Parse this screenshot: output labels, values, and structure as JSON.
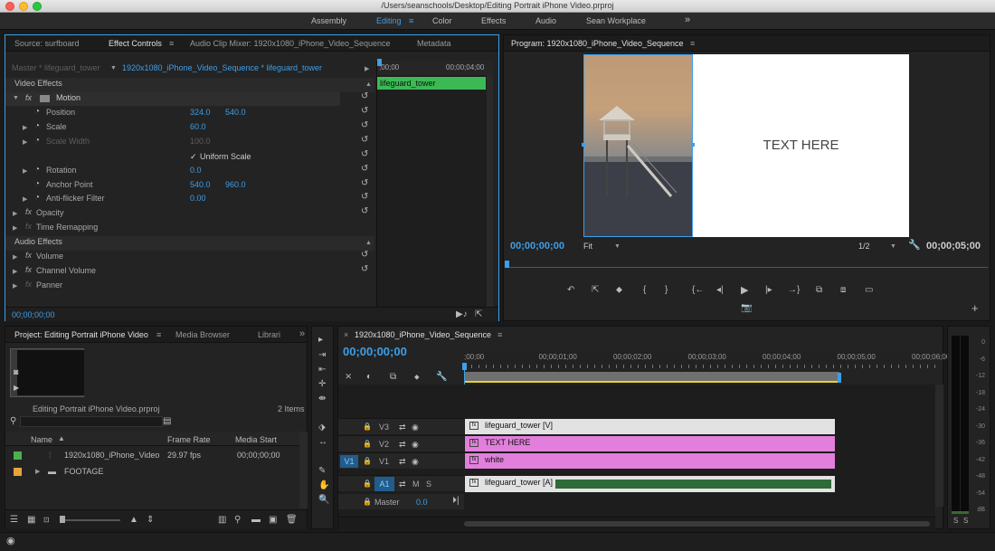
{
  "window": {
    "title": "/Users/seanschools/Desktop/Editing Portrait iPhone Video.prproj"
  },
  "workspaces": {
    "items": [
      "Assembly",
      "Editing",
      "Color",
      "Effects",
      "Audio",
      "Sean Workplace"
    ],
    "more": "»"
  },
  "source_panel": {
    "tabs": [
      "Source: surfboard",
      "Effect Controls",
      "Audio Clip Mixer: 1920x1080_iPhone_Video_Sequence",
      "Metadata"
    ],
    "master_label": "Master * lifeguard_tower",
    "sequence_label": "1920x1080_iPhone_Video_Sequence * lifeguard_tower",
    "ruler_start": ";00;00",
    "ruler_end": "00;00;04;00",
    "clip_label": "lifeguard_tower",
    "video_effects_header": "Video Effects",
    "audio_effects_header": "Audio Effects",
    "fx": "fx",
    "motion": "Motion",
    "position": {
      "label": "Position",
      "x": "324.0",
      "y": "540.0"
    },
    "scale": {
      "label": "Scale",
      "value": "60.0"
    },
    "scale_width": {
      "label": "Scale Width",
      "value": "100.0"
    },
    "uniform_scale": {
      "label": "Uniform Scale",
      "check": "✓"
    },
    "rotation": {
      "label": "Rotation",
      "value": "0.0"
    },
    "anchor_point": {
      "label": "Anchor Point",
      "x": "540.0",
      "y": "960.0"
    },
    "anti_flicker": {
      "label": "Anti-flicker Filter",
      "value": "0.00"
    },
    "opacity": "Opacity",
    "time_remapping": "Time Remapping",
    "volume": "Volume",
    "channel_volume": "Channel Volume",
    "panner": "Panner",
    "timecode": "00;00;00;00"
  },
  "program": {
    "title": "Program: 1920x1080_iPhone_Video_Sequence",
    "overlay_text": "TEXT HERE",
    "timecode_current": "00;00;00;00",
    "fit": "Fit",
    "resolution": "1/2",
    "timecode_duration": "00;00;05;00",
    "transport_icons": [
      "↶",
      "⇱",
      "⬥",
      "{",
      "}",
      "{←",
      "◂|",
      "▶",
      "|▸",
      "→}",
      "⧉",
      "⧈",
      "▭"
    ],
    "camera": "📷",
    "plus": "+"
  },
  "project": {
    "tabs": [
      "Project: Editing Portrait iPhone Video",
      "Media Browser",
      "Librari"
    ],
    "file_name": "Editing Portrait iPhone Video.prproj",
    "item_count": "2 Items",
    "columns": [
      "Name",
      "Frame Rate",
      "Media Start"
    ],
    "rows": [
      {
        "name": "1920x1080_iPhone_Video",
        "rate": "29.97 fps",
        "start": "00;00;00;00",
        "color": "#4caf50"
      },
      {
        "name": "FOOTAGE",
        "rate": "",
        "start": "",
        "color": "#e8a33c"
      }
    ]
  },
  "tools": {
    "icons": [
      "▸",
      "⇥",
      "⇤",
      "✛",
      "⇼",
      "⬗",
      "↔",
      "✎",
      "✋",
      "🔍"
    ]
  },
  "timeline": {
    "title": "1920x1080_iPhone_Video_Sequence",
    "timecode": "00;00;00;00",
    "ruler": [
      ";00;00",
      "00;00;01;00",
      "00;00;02;00",
      "00;00;03;00",
      "00;00;04;00",
      "00;00;05;00",
      "00;00;06;00"
    ],
    "tracks": [
      {
        "name": "V3",
        "clip": "lifeguard_tower [V]",
        "clip_color": "#e2e2e2"
      },
      {
        "name": "V2",
        "clip": "TEXT HERE",
        "clip_color": "#e27fdc"
      },
      {
        "name": "V1",
        "source": "V1",
        "clip": "white",
        "clip_color": "#e27fdc"
      },
      {
        "name": "A1",
        "clip": "lifeguard_tower [A]",
        "clip_color": "#e2e2e2"
      }
    ],
    "master": {
      "label": "Master",
      "value": "0.0"
    },
    "m": "M",
    "s": "S"
  },
  "meter": {
    "ticks": [
      "0",
      "-6",
      "-12",
      "-18",
      "-24",
      "-30",
      "-36",
      "-42",
      "-48",
      "-54",
      "dB"
    ],
    "solo": [
      "S",
      "S"
    ]
  },
  "colors": {
    "accent": "#3e9ee8",
    "clip_green": "#3cb955",
    "text_clip": "#e27fdc",
    "audio_wave": "#2f6a38"
  }
}
